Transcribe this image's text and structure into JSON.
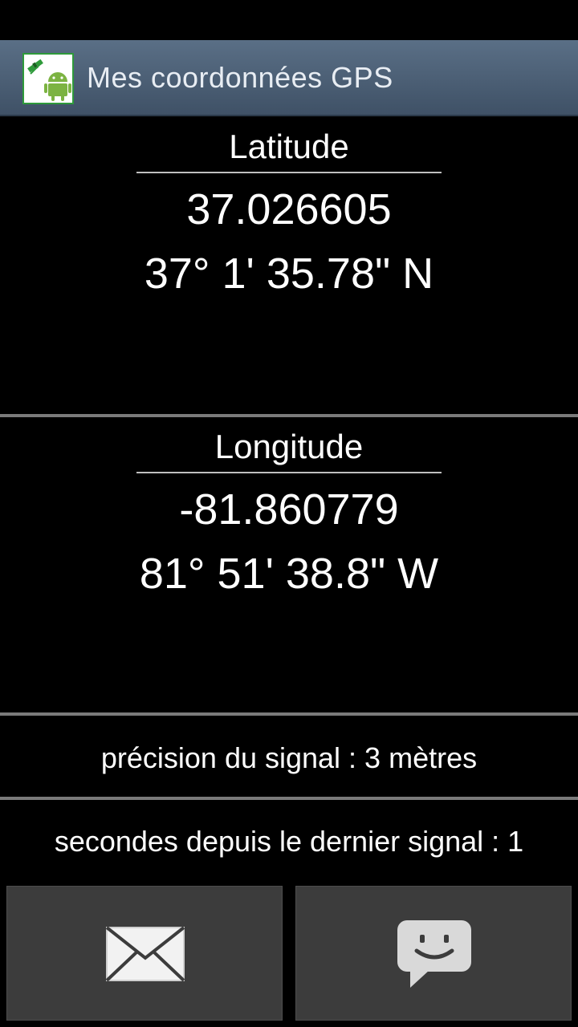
{
  "header": {
    "title": "Mes coordonnées GPS",
    "icon": "gps-android-app-icon"
  },
  "latitude": {
    "label": "Latitude",
    "decimal": "37.026605",
    "dms": "37° 1' 35.78\" N"
  },
  "longitude": {
    "label": "Longitude",
    "decimal": "-81.860779",
    "dms": "81° 51' 38.8\" W"
  },
  "info": {
    "precision": "précision du signal : 3 mètres",
    "seconds": "secondes depuis le dernier signal : 1"
  },
  "actions": {
    "email_icon": "envelope-icon",
    "sms_icon": "chat-bubble-smiley-icon"
  },
  "colors": {
    "action_bar": "#4a5e74",
    "android_green": "#7cb342",
    "button_bg": "#3c3c3c"
  }
}
